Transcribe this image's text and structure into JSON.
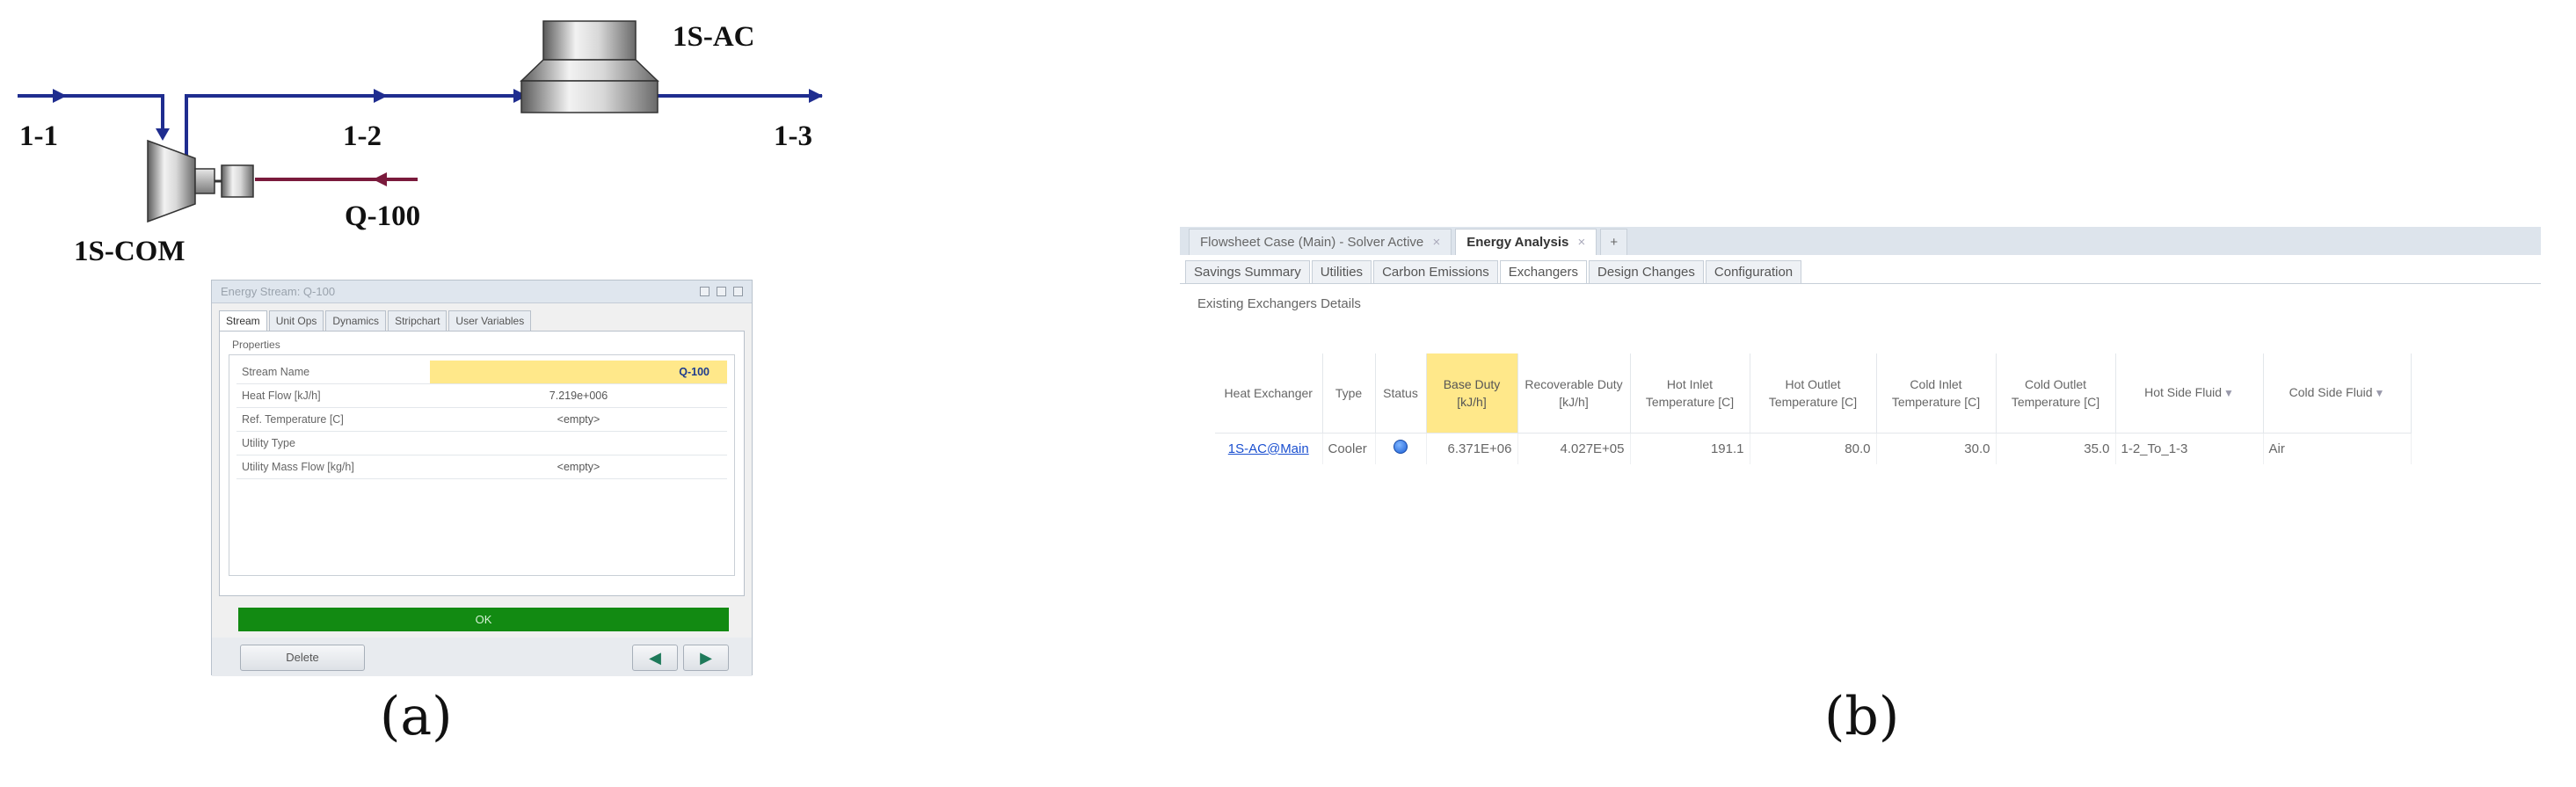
{
  "flowsheet": {
    "labels": {
      "stream_1_1": "1-1",
      "stream_1_2": "1-2",
      "stream_1_3": "1-3",
      "cooler": "1S-AC",
      "compressor": "1S-COM",
      "energy_stream": "Q-100"
    },
    "colors": {
      "material_stream": "#1f2d8f",
      "energy_stream": "#7a1a3c"
    }
  },
  "energy_stream_window": {
    "title": "Energy Stream: Q-100",
    "tabs": [
      "Stream",
      "Unit Ops",
      "Dynamics",
      "Stripchart",
      "User Variables"
    ],
    "active_tab": "Stream",
    "group_label": "Properties",
    "rows": [
      {
        "key": "Stream Name",
        "value": "Q-100"
      },
      {
        "key": "Heat Flow [kJ/h]",
        "value": "7.219e+006"
      },
      {
        "key": "Ref. Temperature [C]",
        "value": "<empty>"
      },
      {
        "key": "Utility Type",
        "value": ""
      },
      {
        "key": "Utility Mass Flow [kg/h]",
        "value": "<empty>"
      }
    ],
    "status": "OK",
    "delete_label": "Delete",
    "status_color": "#128a12"
  },
  "energy_analysis": {
    "doc_tabs": [
      {
        "label": "Flowsheet Case (Main) - Solver Active"
      },
      {
        "label": "Energy Analysis"
      },
      {
        "label": "+"
      }
    ],
    "tabs": [
      "Savings Summary",
      "Utilities",
      "Carbon Emissions",
      "Exchangers",
      "Design Changes",
      "Configuration"
    ],
    "active_tab": "Exchangers",
    "section_title": "Existing Exchangers Details",
    "columns": [
      {
        "label": "Heat Exchanger"
      },
      {
        "label": "Type"
      },
      {
        "label": "Status"
      },
      {
        "label": "Base Duty [kJ/h]"
      },
      {
        "label": "Recoverable Duty [kJ/h]"
      },
      {
        "label": "Hot Inlet Temperature [C]"
      },
      {
        "label": "Hot Outlet Temperature [C]"
      },
      {
        "label": "Cold Inlet Temperature [C]"
      },
      {
        "label": "Cold Outlet Temperature [C]"
      },
      {
        "label": "Hot Side Fluid"
      },
      {
        "label": "Cold Side Fluid"
      }
    ],
    "rows": [
      {
        "heat_exchanger": "1S-AC@Main",
        "type": "Cooler",
        "status_icon": "ok-status-icon",
        "base_duty": "6.371E+06",
        "recoverable_duty": "4.027E+05",
        "hot_inlet_temp": "191.1",
        "hot_outlet_temp": "80.0",
        "cold_inlet_temp": "30.0",
        "cold_outlet_temp": "35.0",
        "hot_side_fluid": "1-2_To_1-3",
        "cold_side_fluid": "Air"
      }
    ]
  },
  "captions": {
    "a": "(a)",
    "b": "(b)"
  }
}
